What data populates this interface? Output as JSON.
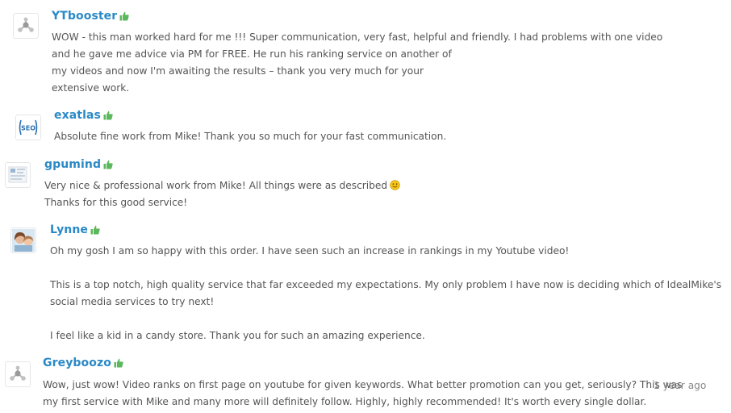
{
  "colors": {
    "name": "#2a89c6",
    "text": "#555555",
    "thumb": "#5cb85c",
    "time": "#888888"
  },
  "reviews": [
    {
      "name": "YTbooster",
      "avatar_icon": "gear-network-icon",
      "lines": [
        "WOW - this man worked hard for me !!! Super communication, very fast, helpful and friendly. I had problems with one video",
        "and he gave me advice via PM for FREE. He run his ranking service on another of",
        "my videos and now I'm awaiting the results – thank you very much for your",
        "extensive work."
      ]
    },
    {
      "name": "exatlas",
      "avatar_icon": "seo-logo",
      "avatar_text": "SEO",
      "lines": [
        "Absolute fine work from Mike! Thank you so much for your fast communication."
      ]
    },
    {
      "name": "gpumind",
      "avatar_icon": "screenshot-thumbnail-icon",
      "lines": [
        "Very nice & professional work from Mike! All things were as described",
        "Thanks for this good service!"
      ]
    },
    {
      "name": "Lynne",
      "avatar_icon": "user-photo",
      "lines": [
        "Oh my gosh I am so happy with this order. I have seen such an increase in rankings in my Youtube video!",
        "",
        "This is a top notch, high quality service that far exceeded my expectations. My only problem I have now is deciding which of IdealMike's",
        "social media services to try next!",
        "",
        "I feel like a kid in a candy store. Thank you for such an amazing experience."
      ]
    },
    {
      "name": "Greyboozo",
      "avatar_icon": "gear-network-icon",
      "lines": [
        "Wow, just wow! Video ranks on first page on youtube for given keywords. What better promotion can you get, seriously? This was",
        "my first service with Mike and many more will definitely follow. Highly, highly recommended! It's worth every single dollar."
      ],
      "time": "1 year ago"
    }
  ]
}
